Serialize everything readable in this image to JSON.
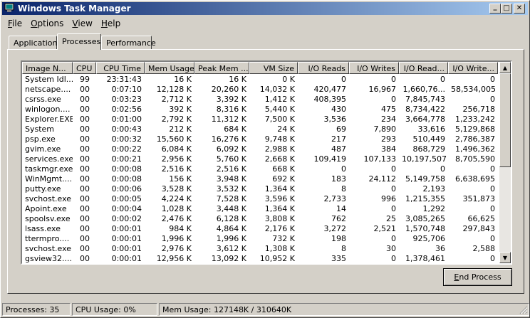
{
  "window": {
    "title": "Windows Task Manager"
  },
  "caption_buttons": {
    "minimize": "_",
    "maximize": "□",
    "close": "✕"
  },
  "menu": [
    {
      "label": "File",
      "ul": "F",
      "rest": "ile"
    },
    {
      "label": "Options",
      "ul": "O",
      "rest": "ptions"
    },
    {
      "label": "View",
      "ul": "V",
      "rest": "iew"
    },
    {
      "label": "Help",
      "ul": "H",
      "rest": "elp"
    }
  ],
  "tabs": [
    {
      "label": "Applications",
      "active": false
    },
    {
      "label": "Processes",
      "active": true
    },
    {
      "label": "Performance",
      "active": false
    }
  ],
  "table": {
    "columns": [
      "Image N...",
      "CPU",
      "CPU Time",
      "Mem Usage",
      "Peak Mem ...",
      "VM Size",
      "I/O Reads",
      "I/O Writes",
      "I/O Read...",
      "I/O Write..."
    ],
    "rows": [
      [
        "System Idl...",
        "99",
        "23:31:43",
        "16 K",
        "16 K",
        "0 K",
        "0",
        "0",
        "0",
        "0"
      ],
      [
        "netscape....",
        "00",
        "0:07:10",
        "12,128 K",
        "20,260 K",
        "14,032 K",
        "420,477",
        "16,967",
        "1,660,76...",
        "58,534,005"
      ],
      [
        "csrss.exe",
        "00",
        "0:03:23",
        "2,712 K",
        "3,392 K",
        "1,412 K",
        "408,395",
        "0",
        "7,845,743",
        "0"
      ],
      [
        "winlogon....",
        "00",
        "0:02:56",
        "392 K",
        "8,316 K",
        "5,440 K",
        "430",
        "475",
        "8,734,422",
        "256,718"
      ],
      [
        "Explorer.EXE",
        "00",
        "0:01:00",
        "2,792 K",
        "11,312 K",
        "7,500 K",
        "3,536",
        "234",
        "3,664,778",
        "1,233,242"
      ],
      [
        "System",
        "00",
        "0:00:43",
        "212 K",
        "684 K",
        "24 K",
        "69",
        "7,890",
        "33,616",
        "5,129,868"
      ],
      [
        "psp.exe",
        "00",
        "0:00:32",
        "15,560 K",
        "16,276 K",
        "9,748 K",
        "217",
        "293",
        "510,449",
        "2,786,387"
      ],
      [
        "gvim.exe",
        "00",
        "0:00:22",
        "6,084 K",
        "6,092 K",
        "2,988 K",
        "487",
        "384",
        "868,729",
        "1,496,362"
      ],
      [
        "services.exe",
        "00",
        "0:00:21",
        "2,956 K",
        "5,760 K",
        "2,668 K",
        "109,419",
        "107,133",
        "10,197,507",
        "8,705,590"
      ],
      [
        "taskmgr.exe",
        "00",
        "0:00:08",
        "2,516 K",
        "2,516 K",
        "668 K",
        "0",
        "0",
        "0",
        "0"
      ],
      [
        "WinMgmt....",
        "00",
        "0:00:08",
        "156 K",
        "3,948 K",
        "692 K",
        "183",
        "24,112",
        "5,149,758",
        "6,638,695"
      ],
      [
        "putty.exe",
        "00",
        "0:00:06",
        "3,528 K",
        "3,532 K",
        "1,364 K",
        "8",
        "0",
        "2,193",
        "0"
      ],
      [
        "svchost.exe",
        "00",
        "0:00:05",
        "4,224 K",
        "7,528 K",
        "3,596 K",
        "2,733",
        "996",
        "1,215,355",
        "351,873"
      ],
      [
        "Apoint.exe",
        "00",
        "0:00:04",
        "1,028 K",
        "3,448 K",
        "1,364 K",
        "14",
        "0",
        "1,292",
        "0"
      ],
      [
        "spoolsv.exe",
        "00",
        "0:00:02",
        "2,476 K",
        "6,128 K",
        "3,808 K",
        "762",
        "25",
        "3,085,265",
        "66,625"
      ],
      [
        "lsass.exe",
        "00",
        "0:00:01",
        "984 K",
        "4,864 K",
        "2,176 K",
        "3,272",
        "2,521",
        "1,570,748",
        "297,843"
      ],
      [
        "ttermpro....",
        "00",
        "0:00:01",
        "1,996 K",
        "1,996 K",
        "732 K",
        "198",
        "0",
        "925,706",
        "0"
      ],
      [
        "svchost.exe",
        "00",
        "0:00:01",
        "2,976 K",
        "3,612 K",
        "1,308 K",
        "8",
        "30",
        "36",
        "2,588"
      ],
      [
        "gsview32....",
        "00",
        "0:00:01",
        "12,956 K",
        "13,092 K",
        "10,952 K",
        "335",
        "0",
        "1,378,461",
        "0"
      ]
    ]
  },
  "buttons": {
    "end_process": "End Process",
    "end_process_ul": "E",
    "end_process_rest": "nd Process"
  },
  "status": {
    "processes": "Processes: 35",
    "cpu_usage": "CPU Usage: 0%",
    "mem_usage": "Mem Usage: 127148K / 310640K"
  },
  "colors": {
    "title_start": "#0a246a",
    "title_end": "#a6caf0",
    "face": "#d4d0c8"
  }
}
